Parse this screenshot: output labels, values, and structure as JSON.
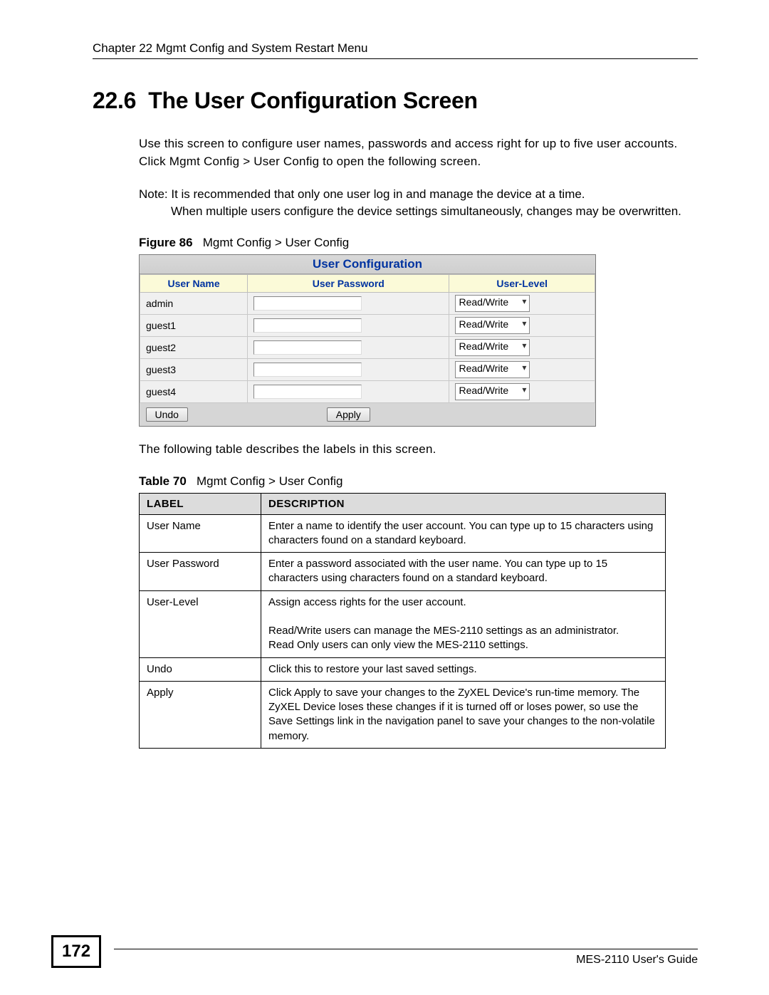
{
  "header": {
    "chapter": "Chapter 22 Mgmt Config and System Restart Menu"
  },
  "section": {
    "number": "22.6",
    "title": "The User Configuration Screen",
    "intro": "Use this screen to configure user names, passwords and access right for up to five user accounts. Click Mgmt Config > User Config to open the following screen.",
    "note_lead": "Note: It is recommended that only one user log in and manage the device at a time.",
    "note_cont": "When multiple users configure the device settings simultaneously, changes may be overwritten."
  },
  "figure": {
    "label": "Figure 86",
    "caption": "Mgmt Config > User Config",
    "ui_title": "User Configuration",
    "columns": {
      "c1": "User Name",
      "c2": "User Password",
      "c3": "User-Level"
    },
    "rows": [
      {
        "user": "admin",
        "level": "Read/Write"
      },
      {
        "user": "guest1",
        "level": "Read/Write"
      },
      {
        "user": "guest2",
        "level": "Read/Write"
      },
      {
        "user": "guest3",
        "level": "Read/Write"
      },
      {
        "user": "guest4",
        "level": "Read/Write"
      }
    ],
    "undo": "Undo",
    "apply": "Apply"
  },
  "post_figure": "The following table describes the labels in this screen.",
  "table": {
    "label": "Table 70",
    "caption": "Mgmt Config > User Config",
    "head_label": "LABEL",
    "head_desc": "DESCRIPTION",
    "rows": [
      {
        "label": "User Name",
        "desc": "Enter a name to identify the user account. You can type up to 15 characters using characters found on a standard keyboard."
      },
      {
        "label": "User Password",
        "desc": "Enter a password associated with the user name. You can type up to 15 characters using characters found on a standard keyboard."
      },
      {
        "label": "User-Level",
        "desc": "Assign access rights for the user account.\n\nRead/Write users can manage the MES-2110 settings as an administrator.\nRead Only users can only view the MES-2110 settings."
      },
      {
        "label": "Undo",
        "desc": "Click this to restore your last saved settings."
      },
      {
        "label": "Apply",
        "desc": "Click Apply to save your changes to the ZyXEL Device's run-time memory. The ZyXEL Device loses these changes if it is turned off or loses power, so use the Save Settings link in the navigation panel to save your changes to the non-volatile memory."
      }
    ]
  },
  "footer": {
    "guide": "MES-2110 User's Guide",
    "page": "172"
  }
}
